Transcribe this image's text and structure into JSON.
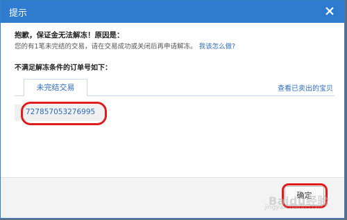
{
  "dialog": {
    "title": "提示",
    "heading": "抱歉，保证金无法解冻！原因是：",
    "reason_text": "您的有1笔未完结的交易，请在交易成功或关闭后再申请解冻。",
    "help_link": "我该怎么做?",
    "subheading": "不满足解冻条件的订单号如下：",
    "tab_label": "未完结交易",
    "sold_link": "查看已卖出的宝贝",
    "orders": [
      "727857053276995"
    ],
    "ok_button": "确定"
  },
  "colors": {
    "titlebar": "#2f7bd0",
    "link": "#2d6bb8",
    "annotation": "#e11b1b"
  },
  "icons": {
    "close": "close-icon"
  },
  "watermark": {
    "brand": "Baidu经验",
    "url": "jingyan.baidu.com"
  }
}
